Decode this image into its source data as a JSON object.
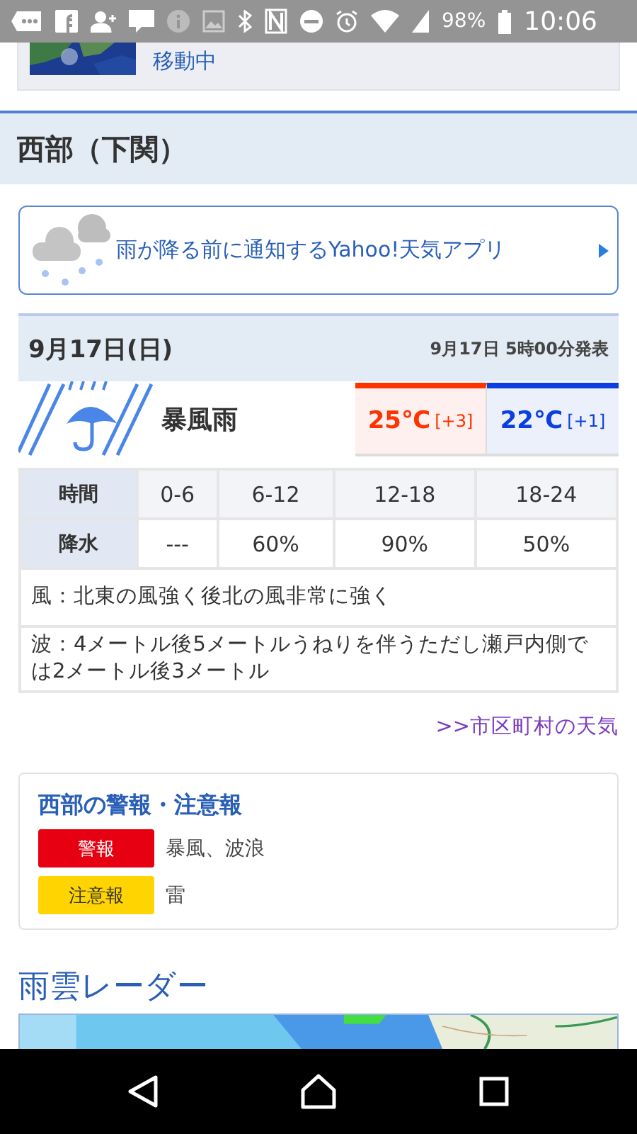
{
  "status_bar": {
    "battery": "98%",
    "time": "10:06"
  },
  "news": {
    "text": "移動中"
  },
  "section": {
    "title": "西部（下関）"
  },
  "app_banner": {
    "text": "雨が降る前に通知するYahoo!天気アプリ"
  },
  "forecast": {
    "date": "9月17日(日)",
    "issued": "9月17日 5時00分発表",
    "weather": "暴風雨",
    "high": {
      "temp": "25℃",
      "diff": "[+3]"
    },
    "low": {
      "temp": "22℃",
      "diff": "[+1]"
    },
    "table": {
      "rows": [
        {
          "header": "時間",
          "cells": [
            "0-6",
            "6-12",
            "12-18",
            "18-24"
          ]
        },
        {
          "header": "降水",
          "cells": [
            "---",
            "60%",
            "90%",
            "50%"
          ]
        }
      ]
    },
    "notes": [
      "風：北東の風強く後北の風非常に強く",
      "波：4メートル後5メートルうねりを伴うただし瀬戸内側では2メートル後3メートル"
    ]
  },
  "city_link": ">>市区町村の天気",
  "warnings": {
    "title": "西部の警報・注意報",
    "items": [
      {
        "label": "警報",
        "kind": "warning",
        "text": "暴風、波浪"
      },
      {
        "label": "注意報",
        "kind": "advisory",
        "text": "雷"
      }
    ]
  },
  "radar": {
    "title": "雨雲レーダー"
  }
}
